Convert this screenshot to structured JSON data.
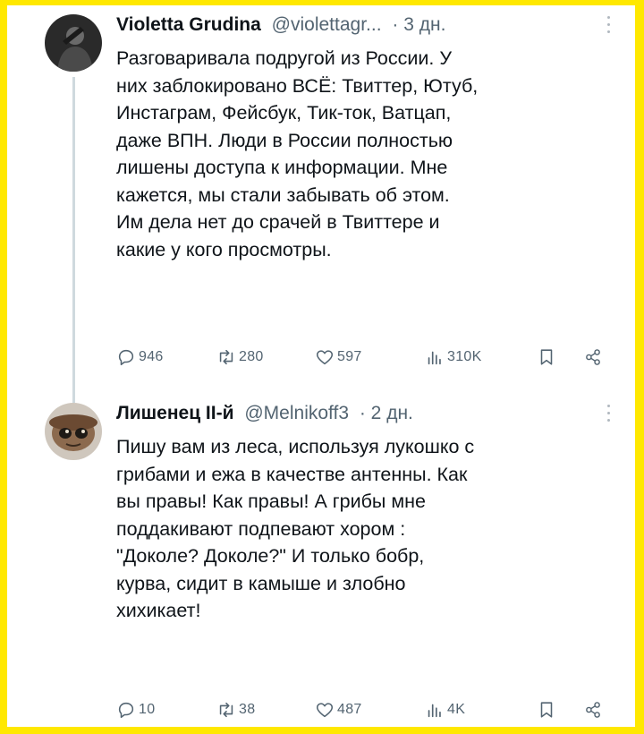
{
  "tweets": [
    {
      "author_name": "Violetta Grudina",
      "handle": "@violettagr...",
      "time": "· 3 дн.",
      "text": "Разговаривала подругой из России. У\nних заблокировано ВСЁ: Твиттер, Ютуб,\nИнстаграм, Фейсбук, Тик-ток, Ватцап,\nдаже ВПН. Люди в России полностью\nлишены доступа к информации. Мне\nкажется, мы стали забывать об этом.\nИм дела нет до срачей в Твиттере и\nкакие у кого просмотры.",
      "stats": {
        "replies": "946",
        "reposts": "280",
        "likes": "597",
        "views": "310K"
      }
    },
    {
      "author_name": "Лишенец II-й",
      "handle": "@Melnikoff3",
      "time": "· 2 дн.",
      "text": "Пишу вам из леса, используя лукошко с\nгрибами и ежа в качестве антенны. Как\nвы правы! Как правы! А грибы мне\nподдакивают подпевают хором :\n\"Доколе? Доколе?\" И только бобр,\nкурва, сидит в камыше и злобно\nхихикает!",
      "stats": {
        "replies": "10",
        "reposts": "38",
        "likes": "487",
        "views": "4K"
      }
    }
  ],
  "icons": {
    "reply": "speech-bubble-icon",
    "repost": "repost-arrows-icon",
    "like": "heart-icon",
    "views": "bar-chart-icon",
    "bookmark": "bookmark-icon",
    "share": "share-icon",
    "more": "more-dots-icon"
  },
  "colors": {
    "frame": "#ffe800",
    "text": "#0f1419",
    "muted": "#536471"
  }
}
